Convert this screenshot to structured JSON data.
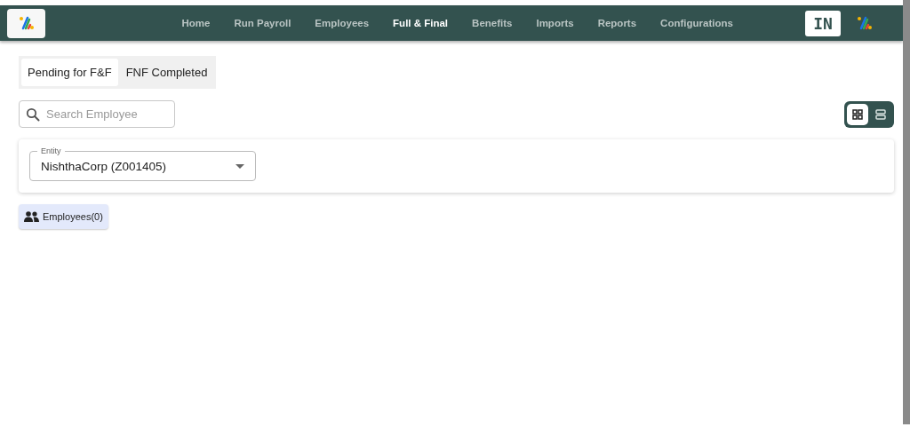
{
  "nav": {
    "items": [
      {
        "label": "Home",
        "selected": false
      },
      {
        "label": "Run Payroll",
        "selected": false
      },
      {
        "label": "Employees",
        "selected": false
      },
      {
        "label": "Full & Final",
        "selected": true
      },
      {
        "label": "Benefits",
        "selected": false
      },
      {
        "label": "Imports",
        "selected": false
      },
      {
        "label": "Reports",
        "selected": false
      },
      {
        "label": "Configurations",
        "selected": false
      }
    ],
    "avatar": "IN"
  },
  "tabs": [
    {
      "label": "Pending for F&F",
      "selected": true
    },
    {
      "label": "FNF Completed",
      "selected": false
    }
  ],
  "search": {
    "placeholder": "Search Employee"
  },
  "view_toggle": [
    {
      "kind": "grid",
      "selected": true
    },
    {
      "kind": "list",
      "selected": false
    }
  ],
  "entity": {
    "label": "Entity",
    "value": "NishthaCorp (Z001405)"
  },
  "employees_chip": {
    "label": "Employees(0)"
  }
}
